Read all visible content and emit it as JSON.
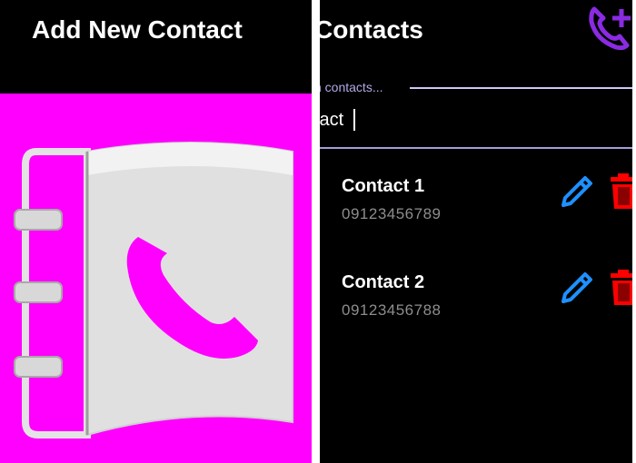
{
  "left_screen": {
    "title": "Add New Contact",
    "hero_image_icon": "address-book-phone-icon",
    "colors": {
      "header_bg": "#000000",
      "hero_bg": "#ff00ff",
      "accent": "#ff00ff"
    }
  },
  "right_screen": {
    "title": "Contacts",
    "add_contact_icon": "phone-plus-icon",
    "search": {
      "label": "h contacts...",
      "value": "tact"
    },
    "contacts": [
      {
        "name": "Contact 1",
        "phone": "09123456789",
        "edit_icon": "pencil-icon",
        "delete_icon": "trash-icon"
      },
      {
        "name": "Contact 2",
        "phone": "09123456788",
        "edit_icon": "pencil-icon",
        "delete_icon": "trash-icon"
      }
    ],
    "colors": {
      "background": "#000000",
      "add_icon": "#8a2be2",
      "edit_icon": "#1e90ff",
      "delete_icon": "#ff0000",
      "search_line": "#cfc8f6"
    }
  }
}
